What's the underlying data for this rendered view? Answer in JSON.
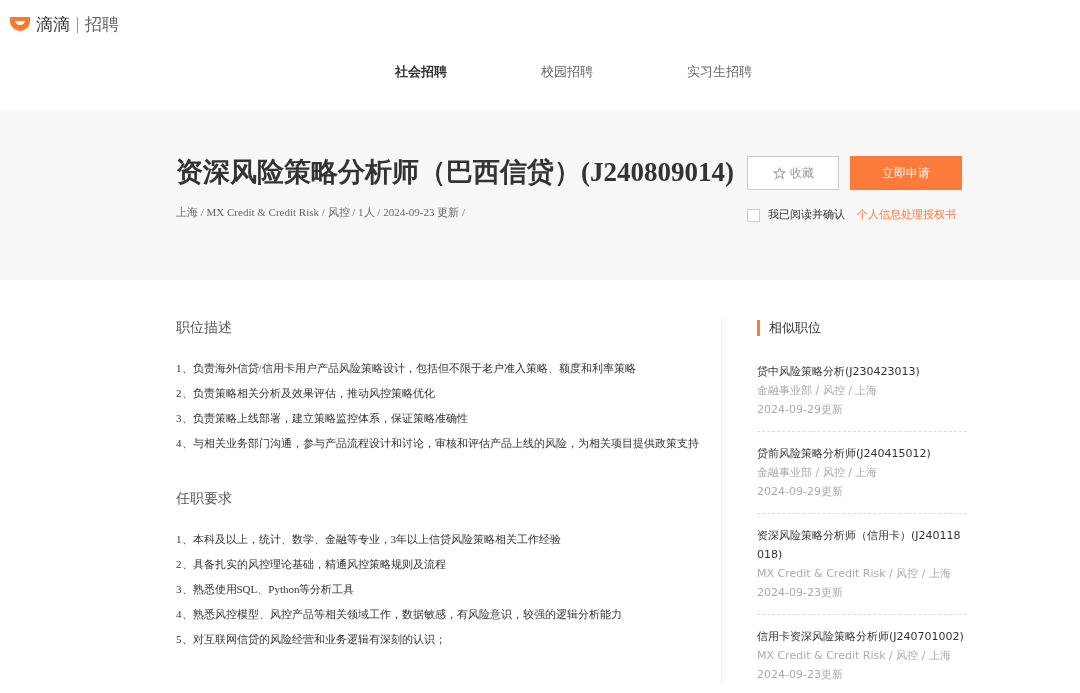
{
  "header": {
    "logo_text": "滴滴",
    "logo_sub": "招聘",
    "nav": [
      {
        "label": "社会招聘",
        "selected": true
      },
      {
        "label": "校园招聘",
        "selected": false
      },
      {
        "label": "实习生招聘",
        "selected": false
      }
    ]
  },
  "job": {
    "title": "资深风险策略分析师（巴西信贷）(J240809014)",
    "meta": "上海 / MX Credit & Credit Risk / 风控 / 1人 / 2024-09-23 更新 /",
    "favorite_label": "收藏",
    "apply_label": "立即申请",
    "consent": {
      "label": "我已阅读并确认",
      "checked": false,
      "link": "个人信息处理授权书"
    }
  },
  "sections": [
    {
      "heading": "职位描述",
      "items": [
        "1、负责海外信贷/信用卡用户产品风险策略设计，包括但不限于老户准入策略、额度和利率策略",
        "2、负责策略相关分析及效果评估，推动风控策略优化",
        "3、负责策略上线部署，建立策略监控体系，保证策略准确性",
        "4、与相关业务部门沟通，参与产品流程设计和讨论，审核和评估产品上线的风险，为相关项目提供政策支持"
      ]
    },
    {
      "heading": "任职要求",
      "items": [
        "1、本科及以上，统计、数学、金融等专业，3年以上信贷风险策略相关工作经验",
        "2、具备扎实的风控理论基础，精通风控策略规则及流程",
        "3、熟悉使用SQL、Python等分析工具",
        "4、熟悉风控模型、风控产品等相关领域工作，数据敏感，有风险意识，较强的逻辑分析能力",
        "5、对互联网信贷的风险经营和业务逻辑有深刻的认识；"
      ]
    }
  ],
  "similar": {
    "heading": "相似职位",
    "jobs": [
      {
        "title": "贷中风险策略分析(J230423013)",
        "meta": "金融事业部 / 风控 / 上海",
        "updated": "2024-09-29更新"
      },
      {
        "title": "贷前风险策略分析师(J240415012)",
        "meta": "金融事业部 / 风控 / 上海",
        "updated": "2024-09-29更新"
      },
      {
        "title": "资深风险策略分析师（信用卡）(J240118018)",
        "meta": "MX Credit & Credit Risk / 风控 / 上海",
        "updated": "2024-09-23更新"
      },
      {
        "title": "信用卡资深风险策略分析师(J240701002)",
        "meta": "MX Credit & Credit Risk / 风控 / 上海",
        "updated": "2024-09-23更新"
      }
    ]
  }
}
